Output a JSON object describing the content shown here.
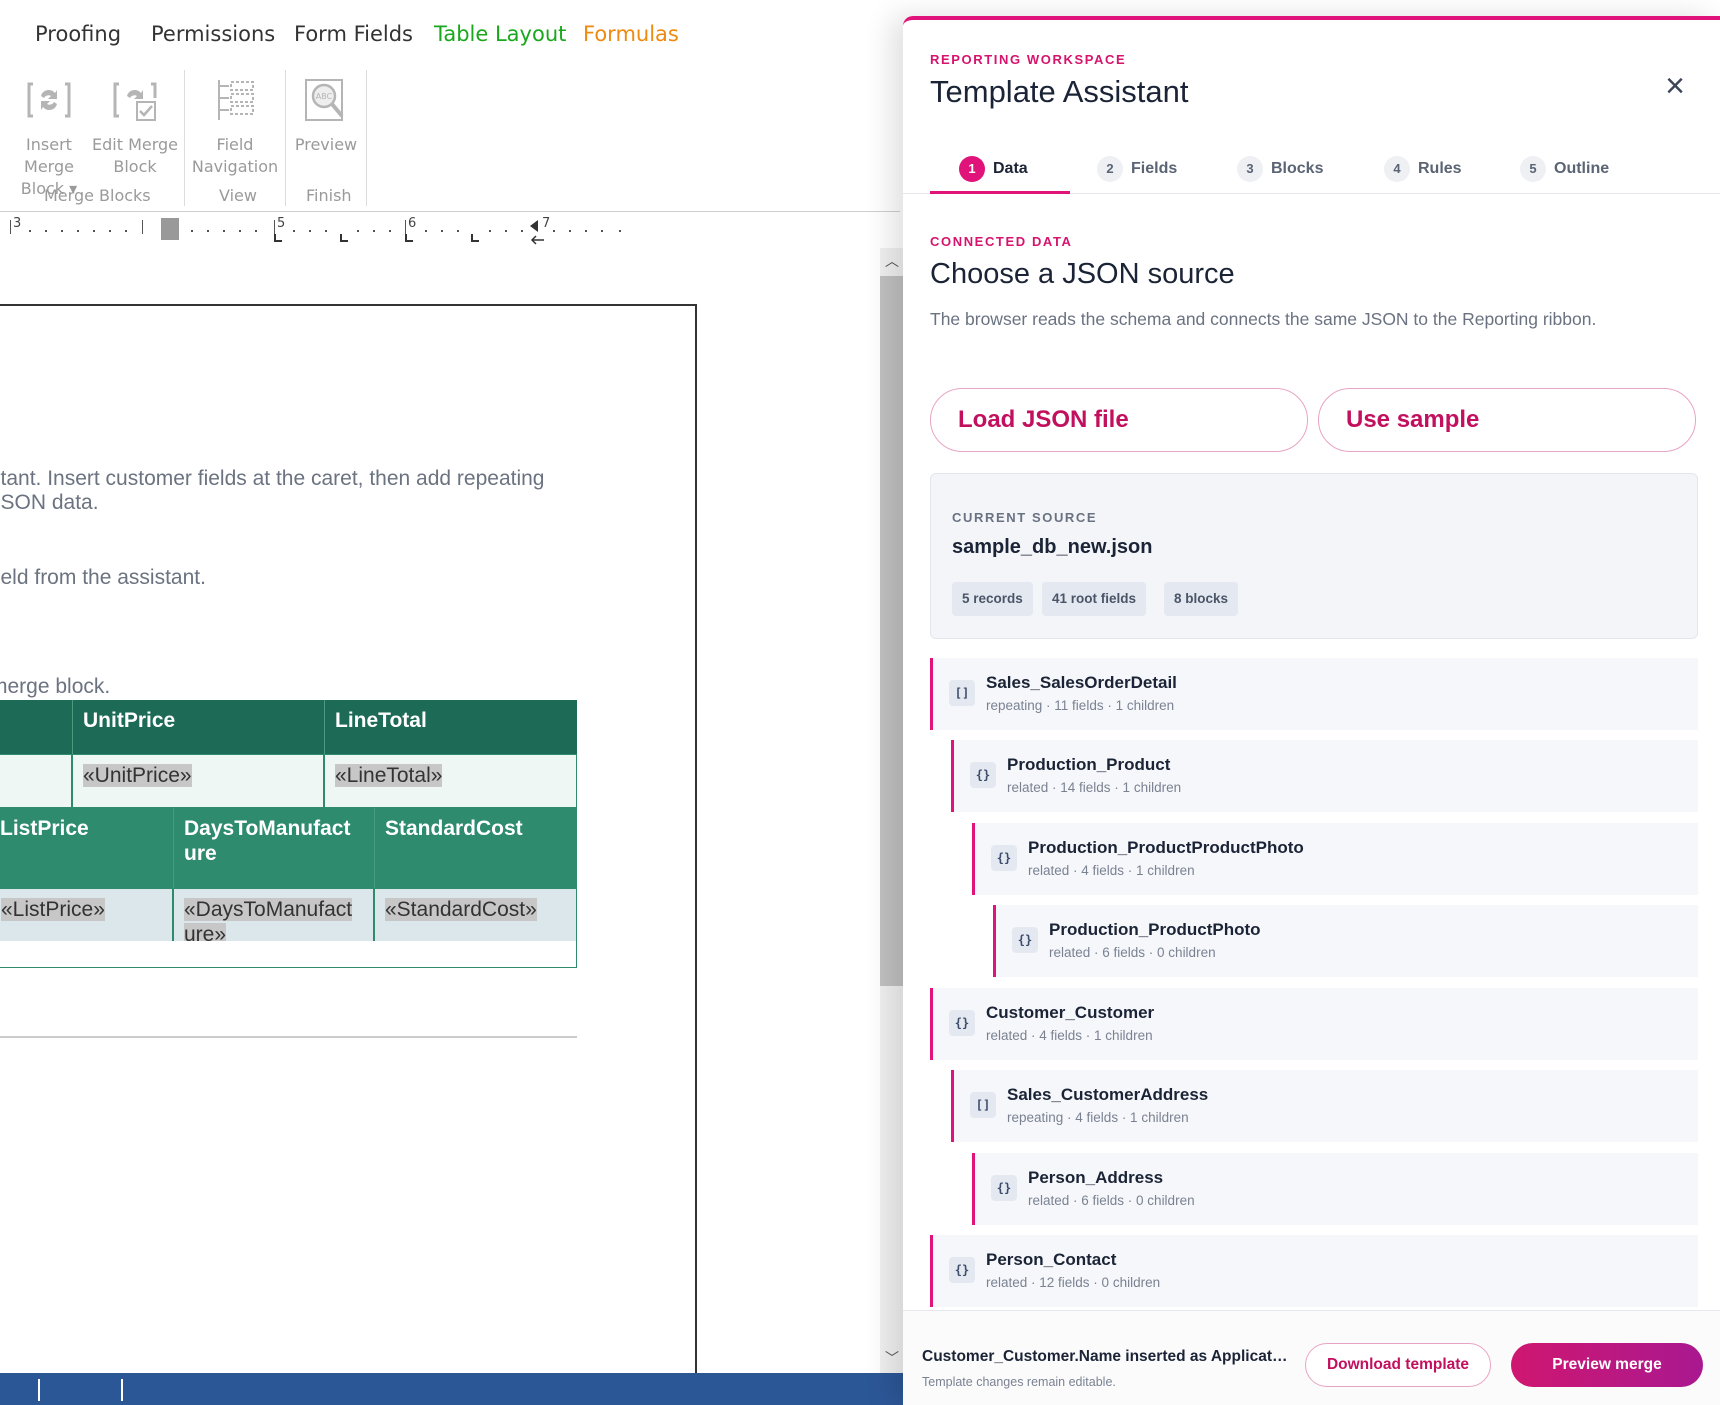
{
  "ribbon": {
    "tabs": [
      {
        "label": "Proofing",
        "color": "#333333"
      },
      {
        "label": "Permissions",
        "color": "#333333"
      },
      {
        "label": "Form Fields",
        "color": "#333333"
      },
      {
        "label": "Table Layout",
        "color": "#19a81d"
      },
      {
        "label": "Formulas",
        "color": "#ef8a10"
      }
    ],
    "buttons": {
      "insert_merge_block": {
        "line1": "Insert Merge",
        "line2": "Block ▾"
      },
      "edit_merge_block": {
        "line1": "Edit Merge",
        "line2": "Block"
      },
      "field_navigation": {
        "line1": "Field",
        "line2": "Navigation"
      },
      "preview": {
        "line1": "Preview"
      }
    },
    "groups": {
      "merge_blocks": "Merge Blocks",
      "view": "View",
      "finish": "Finish"
    }
  },
  "ruler": {
    "n3": "3",
    "n5": "5",
    "n6": "6",
    "n7": "7"
  },
  "document": {
    "line1": "stant. Insert customer fields at the caret, then add repeating",
    "line2": " JSON data.",
    "line3": "field from the assistant.",
    "line4": "merge block.",
    "table1": {
      "headers": [
        "UnitPrice",
        "LineTotal"
      ],
      "cells": [
        "«UnitPrice»",
        "«LineTotal»"
      ]
    },
    "table2": {
      "headers": [
        "ListPrice",
        "DaysToManufact ure",
        "StandardCost"
      ],
      "header_days_line1": "DaysToManufact",
      "header_days_line2": "ure",
      "cells": [
        "«ListPrice»",
        "«StandardCost»"
      ],
      "cell_days_line1": "«DaysToManufact",
      "cell_days_line2": "ure»"
    }
  },
  "assistant": {
    "eyebrow": "REPORTING WORKSPACE",
    "title": "Template Assistant",
    "close_icon": "×",
    "steps": [
      {
        "num": "1",
        "label": "Data",
        "active": true
      },
      {
        "num": "2",
        "label": "Fields"
      },
      {
        "num": "3",
        "label": "Blocks"
      },
      {
        "num": "4",
        "label": "Rules"
      },
      {
        "num": "5",
        "label": "Outline"
      }
    ],
    "section": {
      "eyebrow": "CONNECTED DATA",
      "title": "Choose a JSON source",
      "description": "The browser reads the schema and connects the same JSON to the Reporting ribbon."
    },
    "load_button": "Load JSON file",
    "sample_button": "Use sample",
    "source": {
      "eyebrow": "CURRENT SOURCE",
      "name": "sample_db_new.json",
      "chips": [
        "5 records",
        "41 root fields",
        "8 blocks"
      ]
    },
    "tree": [
      {
        "icon": "[]",
        "name": "Sales_SalesOrderDetail",
        "meta": "repeating · 11 fields · 1 children",
        "depth": 0
      },
      {
        "icon": "{}",
        "name": "Production_Product",
        "meta": "related · 14 fields · 1 children",
        "depth": 1
      },
      {
        "icon": "{}",
        "name": "Production_ProductProductPhoto",
        "meta": "related · 4 fields · 1 children",
        "depth": 2
      },
      {
        "icon": "{}",
        "name": "Production_ProductPhoto",
        "meta": "related · 6 fields · 0 children",
        "depth": 3
      },
      {
        "icon": "{}",
        "name": "Customer_Customer",
        "meta": "related · 4 fields · 1 children",
        "depth": 0
      },
      {
        "icon": "[]",
        "name": "Sales_CustomerAddress",
        "meta": "repeating · 4 fields · 1 children",
        "depth": 1
      },
      {
        "icon": "{}",
        "name": "Person_Address",
        "meta": "related · 6 fields · 0 children",
        "depth": 2
      },
      {
        "icon": "{}",
        "name": "Person_Contact",
        "meta": "related · 12 fields · 0 children",
        "depth": 0
      }
    ],
    "footer": {
      "message": "Customer_Customer.Name inserted as Applicatio...",
      "sub": "Template changes remain editable.",
      "download_button": "Download template",
      "preview_button": "Preview merge"
    }
  },
  "colors": {
    "accent": "#e0137a",
    "table_header_dark": "#1d6b57",
    "table_header_light": "#2e8b6d",
    "status_bar": "#2c5797"
  }
}
